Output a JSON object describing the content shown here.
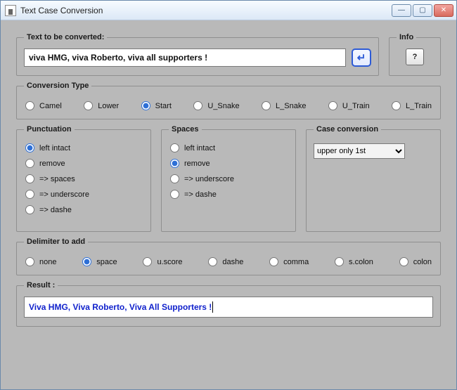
{
  "window": {
    "title": "Text Case Conversion",
    "buttons": {
      "min": "—",
      "max": "▢",
      "close": "✕"
    }
  },
  "input": {
    "legend": "Text to be converted:",
    "value": "viva HMG, viva Roberto, viva all supporters !",
    "enter_glyph": "↵"
  },
  "info": {
    "legend": "Info",
    "btn": "?"
  },
  "conversion_type": {
    "legend": "Conversion Type",
    "options": [
      "Camel",
      "Lower",
      "Start",
      "U_Snake",
      "L_Snake",
      "U_Train",
      "L_Train"
    ],
    "selected": "Start"
  },
  "punctuation": {
    "legend": "Punctuation",
    "options": [
      "left intact",
      "remove",
      "=> spaces",
      "=> underscore",
      "=> dashe"
    ],
    "selected": "left intact"
  },
  "spaces": {
    "legend": "Spaces",
    "options": [
      "left intact",
      "remove",
      "=> underscore",
      "=> dashe"
    ],
    "selected": "remove"
  },
  "case_conversion": {
    "legend": "Case conversion",
    "selected": "upper only 1st",
    "options": [
      "upper only 1st"
    ]
  },
  "delimiter": {
    "legend": "Delimiter to add",
    "options": [
      "none",
      "space",
      "u.score",
      "dashe",
      "comma",
      "s.colon",
      "colon"
    ],
    "selected": "space"
  },
  "result": {
    "legend": "Result :",
    "value": "Viva HMG, Viva Roberto, Viva All Supporters !"
  }
}
